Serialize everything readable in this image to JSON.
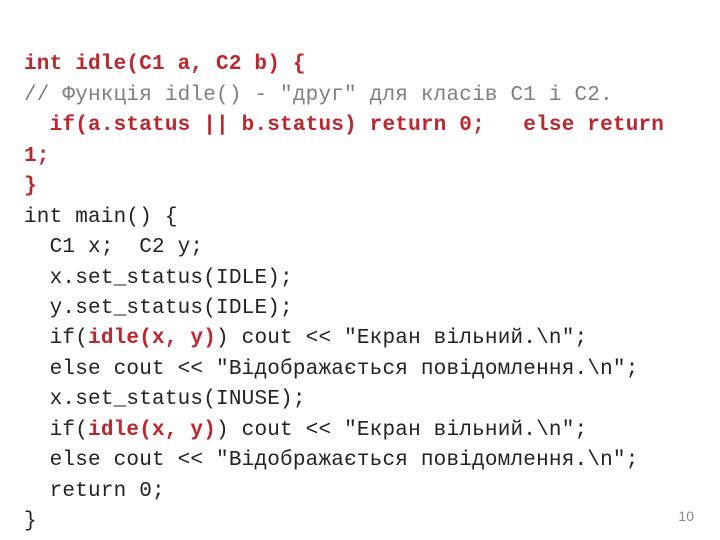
{
  "code": {
    "l1": {
      "a": "int idle(C1 a, C2 b) {"
    },
    "l2": {
      "a": "// Функція idle() - \"друг\" для класів C1 і C2."
    },
    "l3": {
      "a": "  if(a.status || b.status) return 0;   else "
    },
    "l3b": {
      "a": "return 1;"
    },
    "l4": {
      "a": "}"
    },
    "l5": {
      "a": "int main() {"
    },
    "l6": {
      "a": "  C1 x;  C2 y;"
    },
    "l7": {
      "a": "  x.set_status(IDLE);"
    },
    "l8": {
      "a": "  y.set_status(IDLE);"
    },
    "l9": {
      "a": "  if(",
      "b": "idle(x, y)",
      "c": ") cout << \"Екран вільний.\\n\";"
    },
    "l10": {
      "a": "  else cout << \"Відображається повідомлення.\\n\";"
    },
    "l11": {
      "a": "  x.set_status(INUSE);"
    },
    "l12": {
      "a": "  if(",
      "b": "idle(x, y)",
      "c": ") cout << \"Екран вільний.\\n\";"
    },
    "l13": {
      "a": "  else cout << \"Відображається повідомлення.\\n\";"
    },
    "l14": {
      "a": "  return 0;"
    },
    "l15": {
      "a": "}"
    }
  },
  "page_number": "10"
}
